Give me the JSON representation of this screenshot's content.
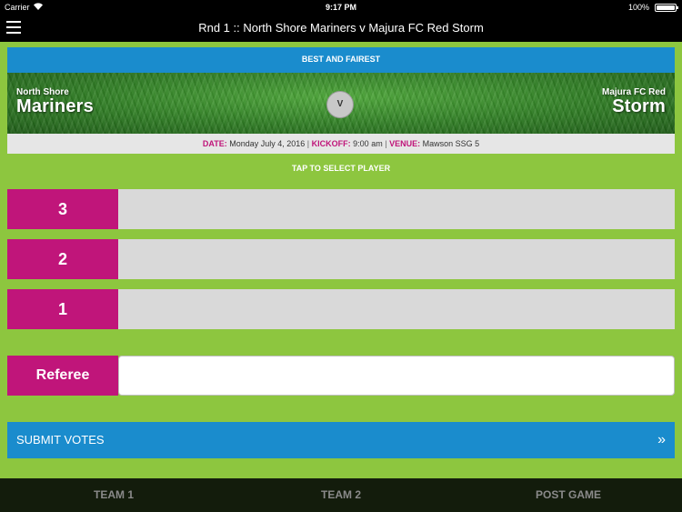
{
  "status_bar": {
    "carrier": "Carrier",
    "time": "9:17 PM",
    "battery": "100%"
  },
  "nav": {
    "title": "Rnd 1 :: North Shore Mariners v Majura FC Red Storm"
  },
  "banner": {
    "title": "BEST AND FAIREST"
  },
  "match": {
    "home": {
      "line1": "North Shore",
      "line2": "Mariners"
    },
    "away": {
      "line1": "Majura FC Red",
      "line2": "Storm"
    },
    "versus": "V",
    "date_label": "DATE:",
    "date": "Monday July 4, 2016",
    "kickoff_label": "KICKOFF:",
    "kickoff": "9:00 am",
    "venue_label": "VENUE:",
    "venue": "Mawson SSG 5"
  },
  "hint": "TAP TO SELECT PLAYER",
  "votes": [
    {
      "points": "3"
    },
    {
      "points": "2"
    },
    {
      "points": "1"
    }
  ],
  "referee": {
    "label": "Referee",
    "value": ""
  },
  "submit": {
    "label": "SUBMIT VOTES",
    "chevron": "»"
  },
  "tabs": [
    "TEAM 1",
    "TEAM 2",
    "POST GAME"
  ],
  "colors": {
    "accent_green": "#8dc63f",
    "magenta": "#c0157a",
    "blue": "#1a8ccd"
  }
}
